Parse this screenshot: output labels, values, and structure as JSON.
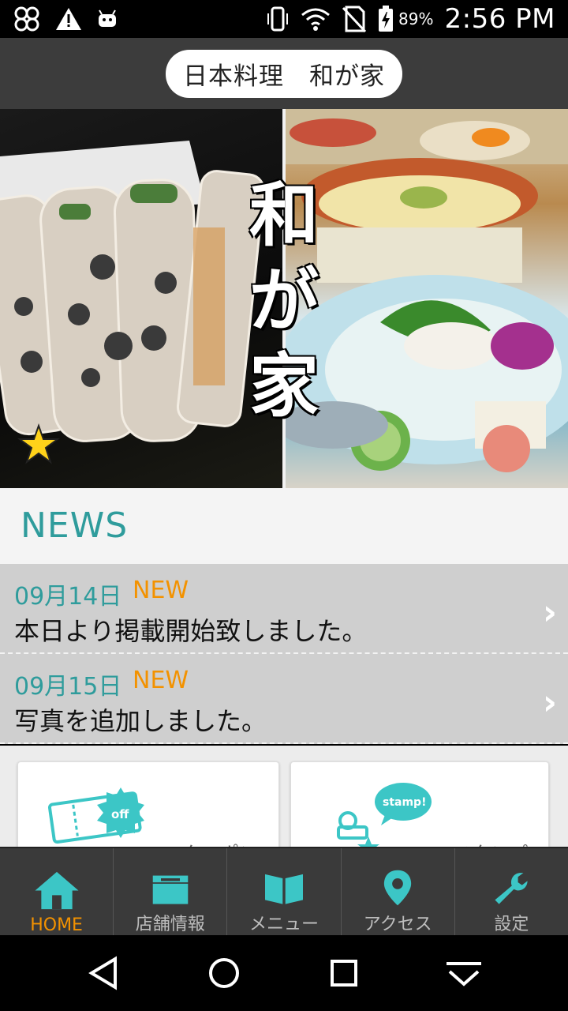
{
  "status_bar": {
    "battery_percent": "89%",
    "time": "2:56 PM",
    "icons": [
      "pinwheel-icon",
      "warning-icon",
      "android-icon",
      "vibrate-icon",
      "wifi-icon",
      "no-sim-icon",
      "battery-charging-icon"
    ]
  },
  "header": {
    "title": "日本料理　和が家"
  },
  "hero": {
    "logo_chars": [
      "和",
      "が",
      "家"
    ],
    "favorite_icon": "star-icon"
  },
  "news": {
    "heading": "NEWS",
    "items": [
      {
        "date": "09月14日",
        "badge": "NEW",
        "text": "本日より掲載開始致しました。"
      },
      {
        "date": "09月15日",
        "badge": "NEW",
        "text": "写真を追加しました。"
      }
    ]
  },
  "cards": {
    "coupon": {
      "label": "クーポン",
      "icon": "coupon-icon",
      "badge": "off"
    },
    "stamp": {
      "label": "スタンプ",
      "icon": "stamp-icon",
      "badge": "stamp!"
    }
  },
  "tabs": [
    {
      "label": "HOME",
      "icon": "home-icon",
      "active": true
    },
    {
      "label": "店舗情報",
      "icon": "shop-icon",
      "active": false
    },
    {
      "label": "メニュー",
      "icon": "menu-book-icon",
      "active": false
    },
    {
      "label": "アクセス",
      "icon": "map-pin-icon",
      "active": false
    },
    {
      "label": "設定",
      "icon": "wrench-icon",
      "active": false
    }
  ],
  "colors": {
    "accent_teal": "#2f9c9c",
    "icon_teal": "#3cc6c6",
    "accent_orange": "#f39200",
    "header_bg": "#3c3c3c"
  }
}
